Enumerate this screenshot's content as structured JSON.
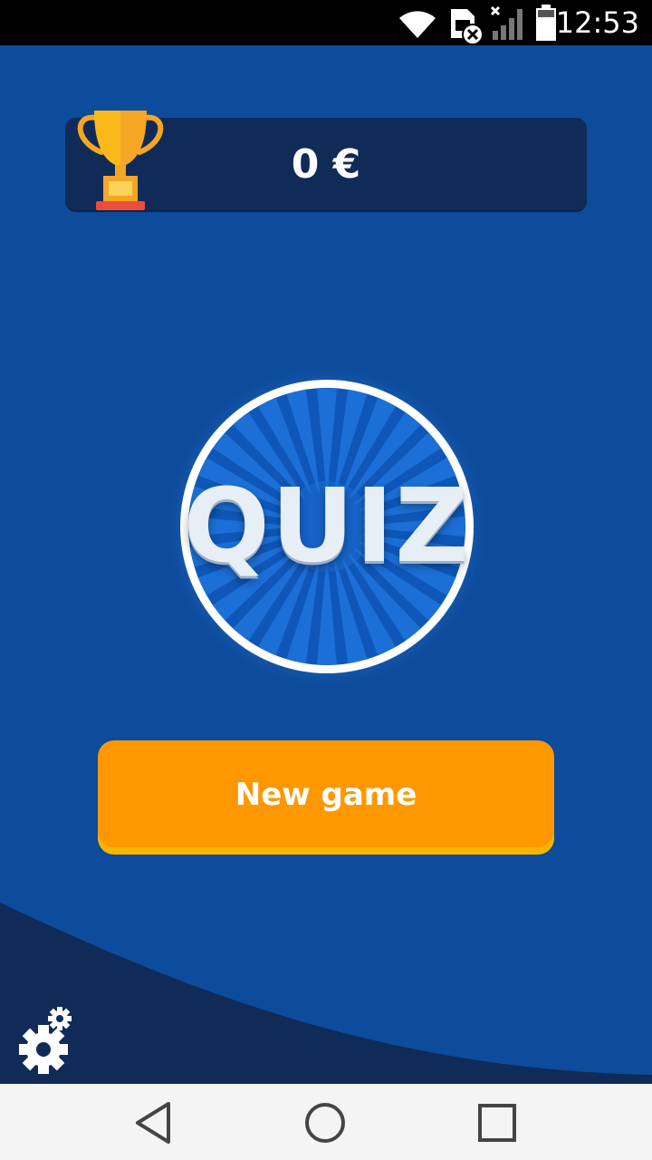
{
  "status_bar": {
    "time": "12:53",
    "icons": [
      "wifi-icon",
      "sim-card-error-icon",
      "cell-signal-icon",
      "battery-icon"
    ]
  },
  "score": {
    "value": "0 €",
    "icon": "trophy-icon"
  },
  "logo": {
    "text": "QUIZ"
  },
  "new_game": {
    "label": "New game"
  },
  "settings": {
    "icon": "gears-icon"
  },
  "nav": {
    "icons": [
      "back-icon",
      "home-icon",
      "recents-icon"
    ]
  },
  "colors": {
    "background": "#0d4b9c",
    "panel": "#102b57",
    "wave": "#102b57",
    "button": "#ff9800",
    "button_shadow": "#f7b500",
    "trophy_gold": "#fbb81b",
    "nav_bar": "#f4f4f4"
  }
}
